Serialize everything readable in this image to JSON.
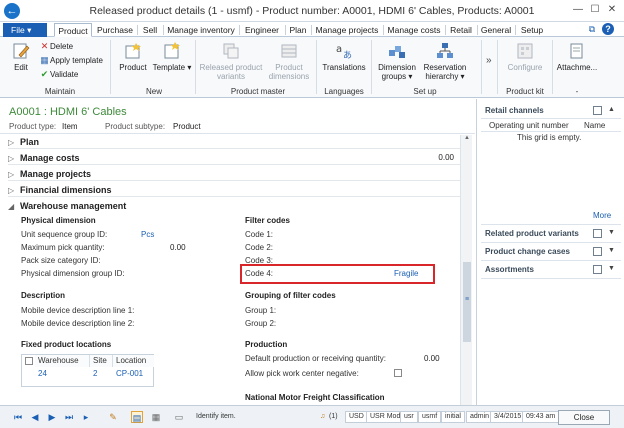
{
  "window": {
    "title": "Released product details (1 - usmf) - Product number: A0001, HDMI 6' Cables, Products: A0001"
  },
  "ribbon_tabs": {
    "file": "File",
    "tabs": [
      "Product",
      "Purchase",
      "Sell",
      "Manage inventory",
      "Engineer",
      "Plan",
      "Manage projects",
      "Manage costs",
      "Retail",
      "General",
      "Setup"
    ]
  },
  "ribbon": {
    "maintain": {
      "edit": "Edit",
      "delete": "Delete",
      "apply_template": "Apply template",
      "validate": "Validate",
      "group": "Maintain"
    },
    "new": {
      "product": "Product",
      "template": "Template",
      "group": "New"
    },
    "product_master": {
      "released_variants": "Released product variants",
      "product_dimensions": "Product dimensions",
      "group": "Product master"
    },
    "languages": {
      "translations": "Translations",
      "group": "Languages"
    },
    "setup": {
      "dimension_groups": "Dimension groups",
      "reservation_hierarchy": "Reservation hierarchy",
      "group": "Set up"
    },
    "product_kit": {
      "configure": "Configure",
      "group": "Product kit"
    },
    "attachments": {
      "label": "Attachme...",
      "group": "-"
    }
  },
  "header": {
    "title": "A0001 : HDMI 6' Cables",
    "product_type_label": "Product type:",
    "product_type": "Item",
    "product_subtype_label": "Product subtype:",
    "product_subtype": "Product"
  },
  "fasttabs": {
    "plan": "Plan",
    "manage_costs": "Manage costs",
    "manage_costs_value": "0.00",
    "manage_projects": "Manage projects",
    "financial_dimensions": "Financial dimensions",
    "warehouse_management": "Warehouse management"
  },
  "warehouse": {
    "physical_dimension": {
      "title": "Physical dimension",
      "unit_sequence_label": "Unit sequence group ID:",
      "unit_sequence_value": "Pcs",
      "max_pick_label": "Maximum pick quantity:",
      "max_pick_value": "0.00",
      "pack_size_label": "Pack size category ID:",
      "phys_dim_group_label": "Physical dimension group ID:"
    },
    "filter_codes": {
      "title": "Filter codes",
      "code1": "Code 1:",
      "code2": "Code 2:",
      "code3": "Code 3:",
      "code4": "Code 4:",
      "code4_value": "Fragile"
    },
    "description": {
      "title": "Description",
      "line1": "Mobile device description line 1:",
      "line2": "Mobile device description line 2:"
    },
    "grouping": {
      "title": "Grouping of filter codes",
      "group1": "Group 1:",
      "group2": "Group 2:"
    },
    "fixed_locations": {
      "title": "Fixed product locations",
      "columns": [
        "Warehouse",
        "Site",
        "Location"
      ],
      "rows": [
        {
          "warehouse": "24",
          "site": "2",
          "location": "CP-001"
        }
      ]
    },
    "production": {
      "title": "Production",
      "default_qty_label": "Default production or receiving quantity:",
      "default_qty_value": "0.00",
      "allow_pick_label": "Allow pick work center negative:"
    },
    "nmfc": {
      "title": "National Motor Freight Classification"
    }
  },
  "right_pane": {
    "retail_channels": "Retail channels",
    "col_operating_unit": "Operating unit number",
    "col_name": "Name",
    "empty_text": "This grid is empty.",
    "more": "More",
    "related_variants": "Related product variants",
    "change_cases": "Product change cases",
    "assortments": "Assortments"
  },
  "status_bar": {
    "hint": "Identify item.",
    "alerts": "(1)",
    "currency": "USD",
    "model": "USR Model",
    "layer": "usr",
    "company": "usmf",
    "partition": "initial",
    "user": "admin",
    "date": "3/4/2015",
    "time": "09:43 am",
    "close": "Close"
  }
}
